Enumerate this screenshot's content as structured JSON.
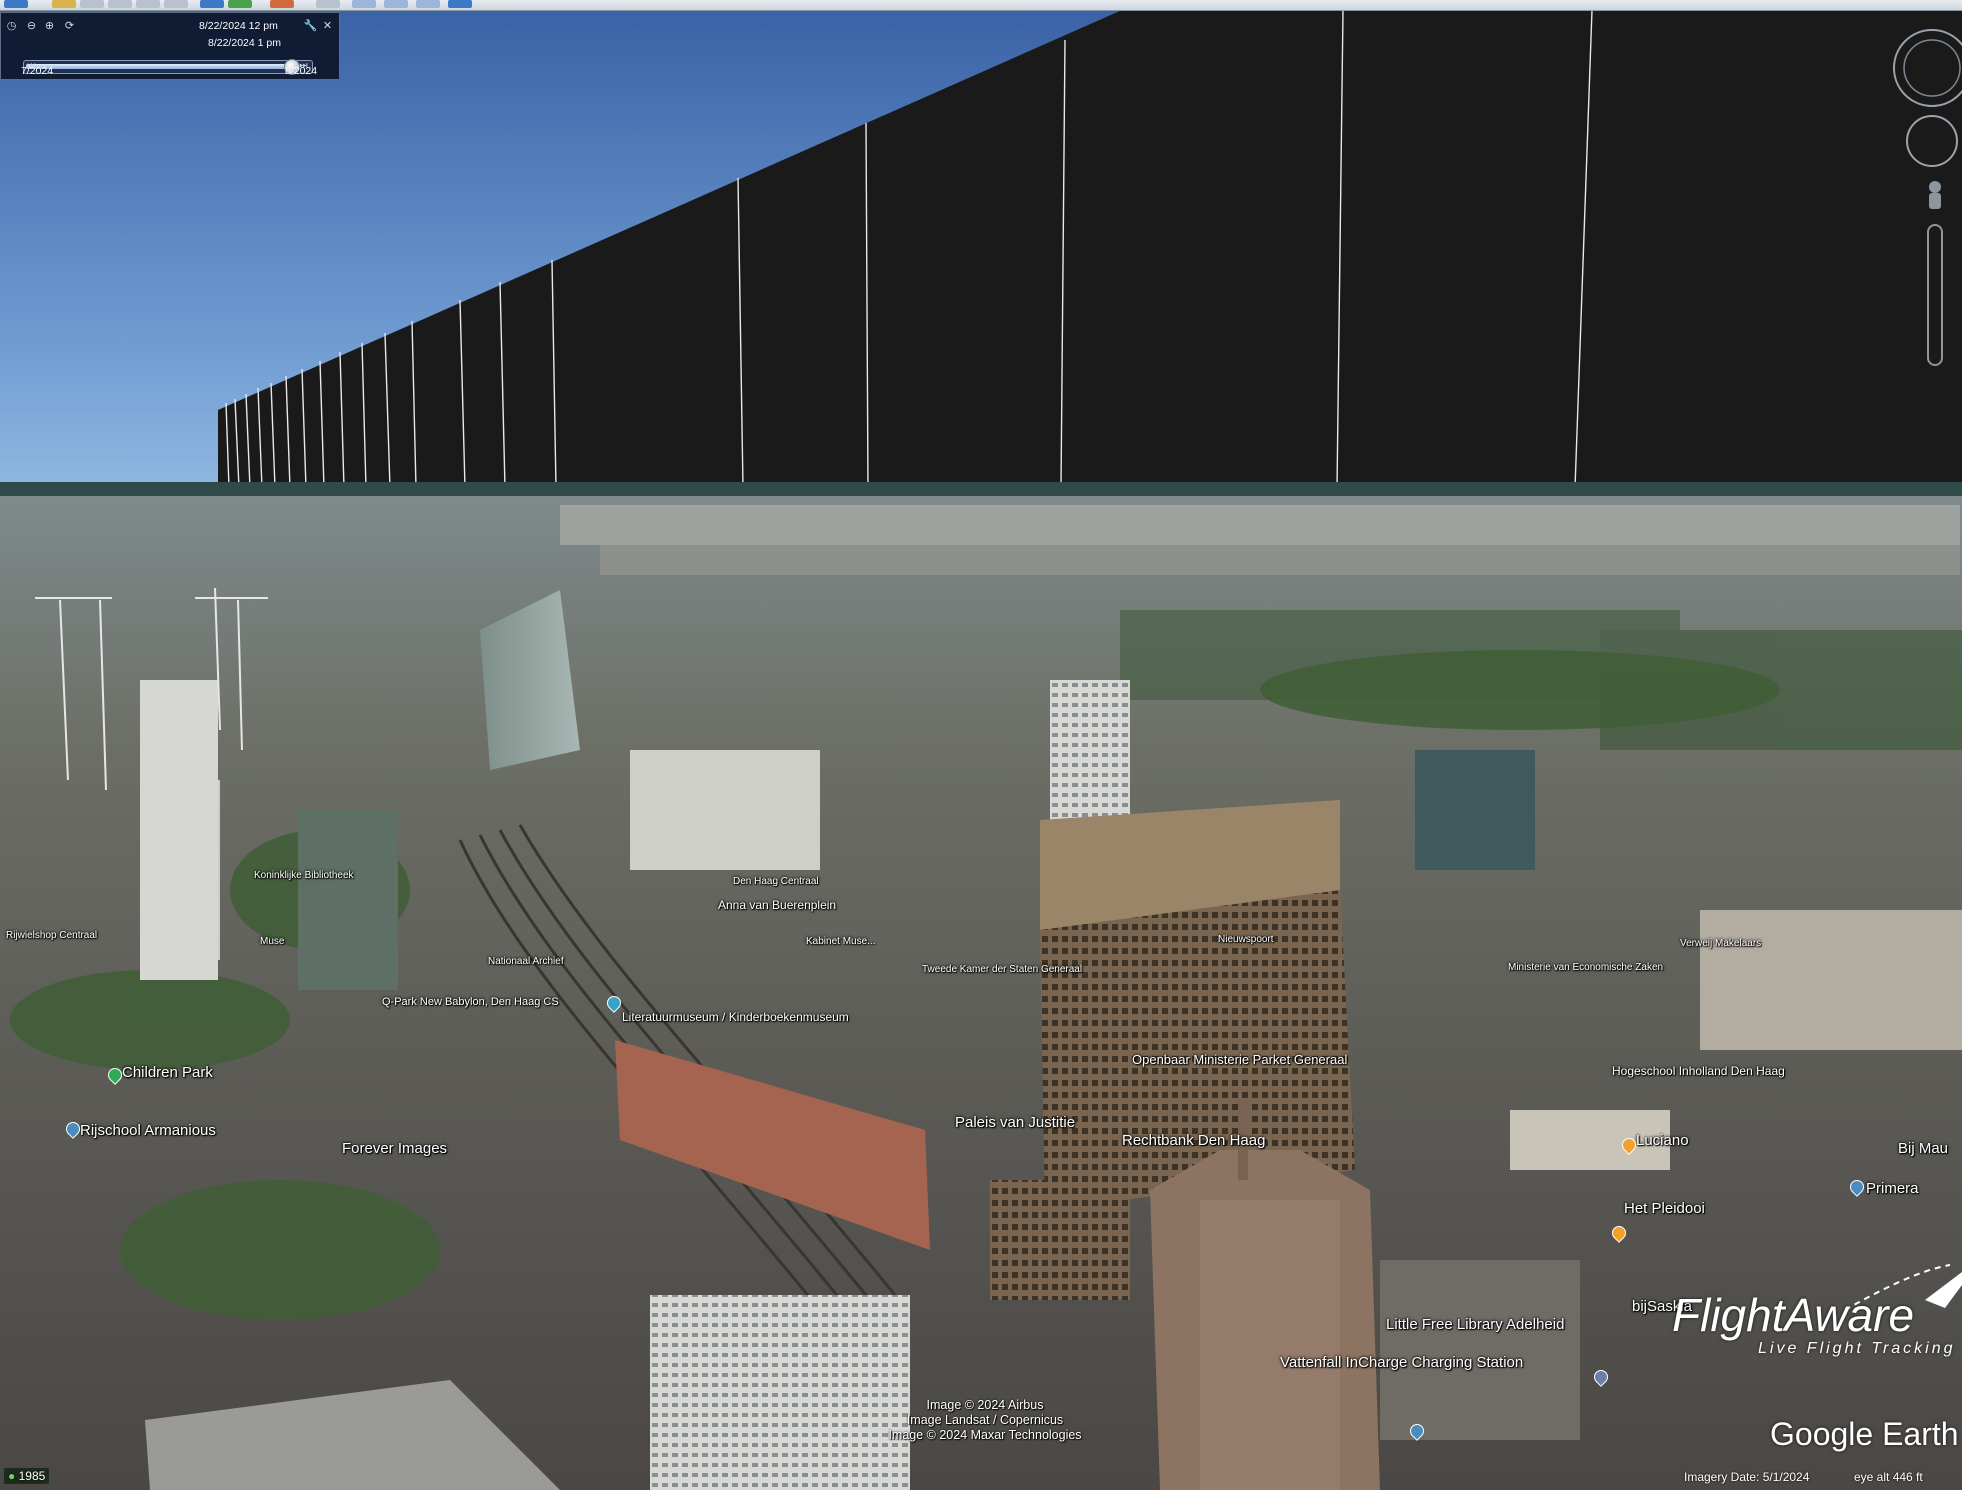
{
  "time_slider": {
    "current_time": "8/22/2024  12 pm",
    "hover_time": "8/22/2024   1 pm",
    "range_start": "7/2024",
    "range_end": "8/2024",
    "position_fraction": 0.95
  },
  "toolbar": {
    "icons": [
      "sidebar-icon",
      "placemark-icon",
      "polygon-icon",
      "path-icon",
      "overlay-icon",
      "tour-icon",
      "history-icon",
      "sun-icon",
      "planets-icon",
      "ruler-icon",
      "email-icon",
      "print-icon",
      "save-image-icon",
      "maps-icon"
    ]
  },
  "map_labels": {
    "children_park": "Children Park",
    "rijschool": "Rijschool Armanious",
    "forever_images": "Forever Images",
    "paleis": "Paleis van Justitie",
    "rechtbank": "Rechtbank Den Haag",
    "openbaar": "Openbaar Ministerie Parket Generaal",
    "literatuur": "Literatuurmuseum / Kinderboekenmuseum",
    "qpark": "Q-Park New Babylon, Den Haag CS",
    "anna": "Anna van Buerenplein",
    "nationaal_archief": "Nationaal Archief",
    "tweede_kamer": "Tweede Kamer der Staten Generaal",
    "hogeschool": "Hogeschool Inholland Den Haag",
    "luciano": "Luciano",
    "primera": "Primera",
    "bij_mau": "Bij Mau",
    "het_pleidooi": "Het Pleidooi",
    "bijsaskia": "bijSaskia",
    "little_free_library": "Little Free Library Adelheid",
    "vattenfall": "Vattenfall InCharge Charging Station",
    "rijwielshop": "Rijwielshop Centraal",
    "verweij": "Verweij Makelaars",
    "ministerie_ez": "Ministerie van Economische Zaken",
    "nieuwspoort": "Nieuwspoort",
    "kon_bib": "Koninklijke Bibliotheek",
    "den_haag_centraal": "Den Haag Centraal",
    "muse": "Muse",
    "kabinet": "Kabinet Muse..."
  },
  "attribution": {
    "line1": "Image © 2024 Airbus",
    "line2": "Image Landsat / Copernicus",
    "line3": "Image © 2024 Maxar Technologies"
  },
  "status_bar": {
    "year": "1985",
    "imagery_date": "Imagery Date: 5/1/2024",
    "eye_alt": "eye alt   446 ft"
  },
  "logos": {
    "flightaware": "FlightAware",
    "flightaware_tagline": "Live Flight Tracking",
    "google_earth": "Google Earth"
  },
  "colors": {
    "sky_top": "#3a62a6",
    "sky_horizon": "#9cc3e6",
    "wall": "#1a1a1a",
    "wall_lines": "#e8e8e8",
    "slider_bg": "#0f1c33"
  }
}
